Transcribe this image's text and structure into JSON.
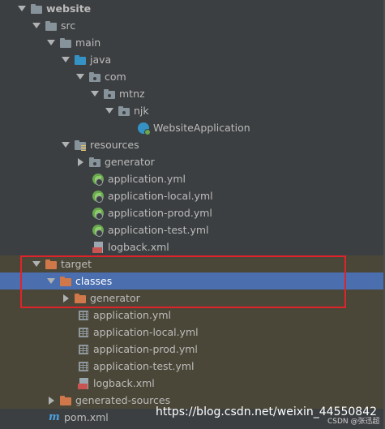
{
  "tree": {
    "rows": [
      {
        "label": "website",
        "icon": "module-folder-icon",
        "state": "expanded"
      },
      {
        "label": "src",
        "icon": "folder-icon",
        "state": "expanded"
      },
      {
        "label": "main",
        "icon": "folder-icon",
        "state": "expanded"
      },
      {
        "label": "java",
        "icon": "source-root-folder-icon",
        "state": "expanded"
      },
      {
        "label": "com",
        "icon": "package-icon",
        "state": "expanded"
      },
      {
        "label": "mtnz",
        "icon": "package-icon",
        "state": "expanded"
      },
      {
        "label": "njk",
        "icon": "package-icon",
        "state": "expanded"
      },
      {
        "label": "WebsiteApplication",
        "icon": "spring-boot-class-icon",
        "state": "leaf"
      },
      {
        "label": "resources",
        "icon": "resources-folder-icon",
        "state": "expanded"
      },
      {
        "label": "generator",
        "icon": "package-icon",
        "state": "collapsed"
      },
      {
        "label": "application.yml",
        "icon": "spring-config-icon",
        "state": "leaf"
      },
      {
        "label": "application-local.yml",
        "icon": "spring-config-icon",
        "state": "leaf"
      },
      {
        "label": "application-prod.yml",
        "icon": "spring-config-icon",
        "state": "leaf"
      },
      {
        "label": "application-test.yml",
        "icon": "spring-config-icon",
        "state": "leaf"
      },
      {
        "label": "logback.xml",
        "icon": "xml-file-icon",
        "state": "leaf"
      },
      {
        "label": "target",
        "icon": "excluded-folder-icon",
        "state": "expanded"
      },
      {
        "label": "classes",
        "icon": "excluded-folder-icon",
        "state": "expanded"
      },
      {
        "label": "generator",
        "icon": "excluded-folder-icon",
        "state": "collapsed"
      },
      {
        "label": "application.yml",
        "icon": "yml-file-icon",
        "state": "leaf"
      },
      {
        "label": "application-local.yml",
        "icon": "yml-file-icon",
        "state": "leaf"
      },
      {
        "label": "application-prod.yml",
        "icon": "yml-file-icon",
        "state": "leaf"
      },
      {
        "label": "application-test.yml",
        "icon": "yml-file-icon",
        "state": "leaf"
      },
      {
        "label": "logback.xml",
        "icon": "xml-file-icon",
        "state": "leaf"
      },
      {
        "label": "generated-sources",
        "icon": "excluded-folder-icon",
        "state": "collapsed"
      },
      {
        "label": "pom.xml",
        "icon": "maven-icon",
        "state": "leaf"
      }
    ]
  },
  "selected_item": "classes",
  "watermark": {
    "url_text": "https://blog.csdn.net/weixin_44550842",
    "site_text": "CSDN @张迅超"
  },
  "colors": {
    "background": "#3c3f41",
    "selection": "#4b6eaf",
    "excluded_row": "#4b4738",
    "highlight_box": "#e0232a"
  }
}
